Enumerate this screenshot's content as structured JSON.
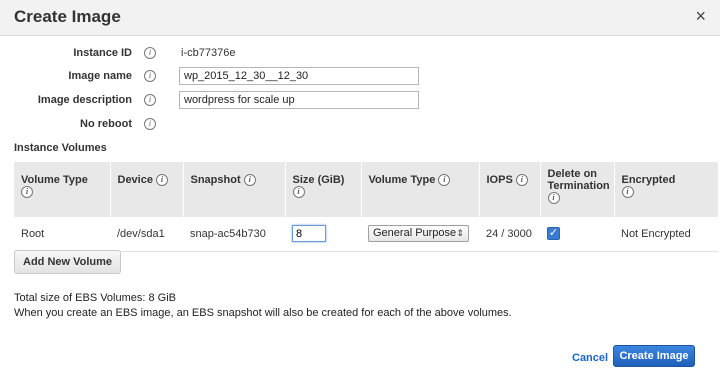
{
  "dialog": {
    "title": "Create Image",
    "close_icon": "×"
  },
  "form": {
    "instance_id": {
      "label": "Instance ID",
      "value": "i-cb77376e"
    },
    "image_name": {
      "label": "Image name",
      "value": "wp_2015_12_30__12_30"
    },
    "image_description": {
      "label": "Image description",
      "value": "wordpress for scale up"
    },
    "no_reboot": {
      "label": "No reboot"
    },
    "info_glyph": "i"
  },
  "volumes": {
    "section_title": "Instance Volumes",
    "headers": {
      "volume_type": "Volume Type",
      "device": "Device",
      "snapshot": "Snapshot",
      "size": "Size (GiB)",
      "volume_type2": "Volume Type",
      "iops": "IOPS",
      "delete_on_termination": "Delete on Termination",
      "encrypted": "Encrypted"
    },
    "rows": [
      {
        "volume_type": "Root",
        "device": "/dev/sda1",
        "snapshot": "snap-ac54b730",
        "size": "8",
        "ebs_type": "General Purpose",
        "iops": "24 / 3000",
        "delete_on_termination": true,
        "encrypted": "Not Encrypted"
      }
    ],
    "add_button": "Add New Volume"
  },
  "summary": {
    "total": "Total size of EBS Volumes: 8 GiB",
    "note": "When you create an EBS image, an EBS snapshot will also be created for each of the above volumes."
  },
  "footer": {
    "cancel": "Cancel",
    "create": "Create Image"
  },
  "colors": {
    "primary_button": "#1f5fb8",
    "link": "#1c63c9",
    "header_bg": "#f2f2f2"
  },
  "icons": {
    "info": "info-circle-icon",
    "close": "close-icon",
    "select_arrow": "updown-arrows-icon",
    "checkbox": "checkmark-icon"
  }
}
